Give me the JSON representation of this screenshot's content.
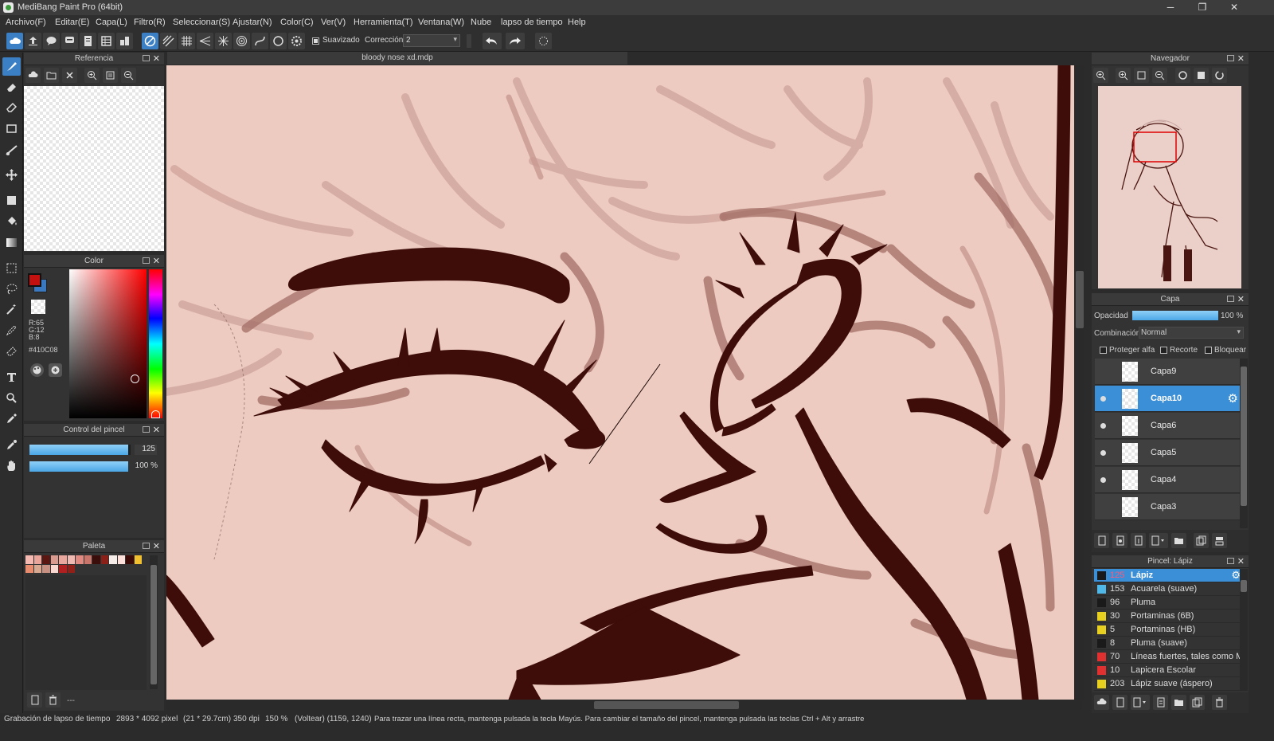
{
  "window": {
    "title": "MediBang Paint Pro (64bit)",
    "buttons": [
      "─",
      "❐",
      "✕"
    ]
  },
  "menu": [
    "Archivo(F)",
    "Editar(E)",
    "Capa(L)",
    "Filtro(R)",
    "Seleccionar(S)",
    "Ajustar(N)",
    "Color(C)",
    "Ver(V)",
    "Herramienta(T)",
    "Ventana(W)",
    "Nube",
    "lapso de tiempo",
    "Help"
  ],
  "toolbar": {
    "suavizado_label": "Suavizado",
    "correccion_label": "Corrección",
    "correccion_value": "2"
  },
  "reference_panel": {
    "title": "Referencia"
  },
  "color_panel": {
    "title": "Color",
    "r": "R:65",
    "g": "G:12",
    "b": "B:8",
    "hex": "#410C08",
    "primary_color": "#c2110f",
    "secondary_color": "#3a78c0"
  },
  "brush_control": {
    "title": "Control del pincel",
    "size_value": "125",
    "opacity_value": "100 %",
    "size_fraction": 0.98,
    "opacity_fraction": 1.0
  },
  "palette": {
    "title": "Paleta",
    "swatches": [
      "#f4b9b0",
      "#eaa49a",
      "#5a1610",
      "#d99a90",
      "#e8a89e",
      "#f0bab2",
      "#e08a82",
      "#c8766c",
      "#3a0e0a",
      "#8a2018",
      "#f6ece8",
      "#fde0da",
      "#3b0a06",
      "#f0c030",
      "#e88c70",
      "#d8a890",
      "#c89080",
      "#f8d8d0",
      "#b02020",
      "#902018"
    ],
    "footer_text": "---"
  },
  "document": {
    "tab_title": "bloody nose xd.mdp"
  },
  "navigator": {
    "title": "Navegador"
  },
  "layers_panel": {
    "title": "Capa",
    "opacity_label": "Opacidad",
    "opacity_value": "100 %",
    "opacity_fraction": 1.0,
    "blend_label": "Combinación",
    "blend_value": "Normal",
    "protect_alpha": "Proteger alfa",
    "clip": "Recorte",
    "lock": "Bloquear",
    "layers": [
      {
        "name": "Capa9",
        "visible": false,
        "selected": false
      },
      {
        "name": "Capa10",
        "visible": true,
        "selected": true
      },
      {
        "name": "Capa6",
        "visible": true,
        "selected": false
      },
      {
        "name": "Capa5",
        "visible": true,
        "selected": false
      },
      {
        "name": "Capa4",
        "visible": true,
        "selected": false
      },
      {
        "name": "Capa3",
        "visible": false,
        "selected": false
      }
    ]
  },
  "brush_panel": {
    "title": "Pincel: Lápiz",
    "brushes": [
      {
        "size": "125",
        "name": "Lápiz",
        "color": "#1a1a1a",
        "selected": true
      },
      {
        "size": "153",
        "name": "Acuarela (suave)",
        "color": "#4fb8e8",
        "selected": false
      },
      {
        "size": "96",
        "name": "Pluma",
        "color": "#1a1a1a",
        "selected": false
      },
      {
        "size": "30",
        "name": "Portaminas (6B)",
        "color": "#e8d020",
        "selected": false
      },
      {
        "size": "5",
        "name": "Portaminas (HB)",
        "color": "#e8d020",
        "selected": false
      },
      {
        "size": "8",
        "name": "Pluma (suave)",
        "color": "#1a1a1a",
        "selected": false
      },
      {
        "size": "70",
        "name": "Líneas fuertes, tales como Ma",
        "color": "#e03030",
        "selected": false
      },
      {
        "size": "10",
        "name": "Lapicera Escolar",
        "color": "#e03030",
        "selected": false
      },
      {
        "size": "203",
        "name": "Lápiz suave (áspero)",
        "color": "#e8d020",
        "selected": false
      }
    ]
  },
  "status": {
    "recording": "Grabación de lapso de tiempo",
    "size": "2893 * 4092 pixel",
    "cm": "(21 * 29.7cm)",
    "dpi": "350 dpi",
    "zoom": "150 %",
    "coords": "(Voltear) (1159, 1240)",
    "hint": "Para trazar una línea recta, mantenga pulsada la tecla Mayús. Para cambiar el tamaño del pincel, mantenga pulsada las teclas Ctrl + Alt y arrastre"
  }
}
